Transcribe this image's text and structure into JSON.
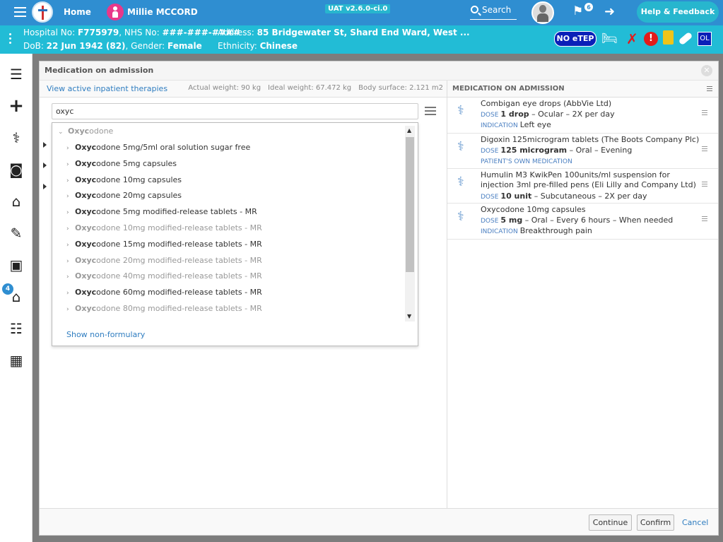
{
  "topbar": {
    "home_label": "Home",
    "patient_name": "Millie MCCORD",
    "environment": "UAT v2.6.0-ci.0",
    "search_label": "Search",
    "flag_count": "6",
    "help_label": "Help & Feedback"
  },
  "banner": {
    "hospital_label": "Hospital No: ",
    "hospital_no": "F775979",
    "nhs_label": ", NHS No: ",
    "nhs_no": "###-###-####",
    "dob_label": "DoB: ",
    "dob": "22 Jun 1942 (82)",
    "gender_label": ", Gender: ",
    "gender": "Female",
    "address_label": "Address: ",
    "address": "85 Bridgewater St, Shard End Ward, West ...",
    "ethnicity_label": "Ethnicity: ",
    "ethnicity": "Chinese",
    "etep_label": "NO eTEP",
    "ol_label": "OL"
  },
  "sidebar": {
    "badge_count": "4"
  },
  "modal": {
    "title": "Medication on admission",
    "view_link": "View active inpatient therapies",
    "actual_weight": "Actual weight: 90 kg",
    "ideal_weight": "Ideal weight: 67.472 kg",
    "body_surface": "Body surface: 2.121 m2",
    "search_value": "oxyc",
    "group_bold": "Oxyc",
    "group_rest": "odone",
    "show_non_formulary": "Show non-formulary",
    "results": [
      {
        "bold": "Oxyc",
        "rest": "odone 5mg/5ml oral solution sugar free",
        "dim": false
      },
      {
        "bold": "Oxyc",
        "rest": "odone 5mg capsules",
        "dim": false
      },
      {
        "bold": "Oxyc",
        "rest": "odone 10mg capsules",
        "dim": false
      },
      {
        "bold": "Oxyc",
        "rest": "odone 20mg capsules",
        "dim": false
      },
      {
        "bold": "Oxyc",
        "rest": "odone 5mg modified-release tablets - MR",
        "dim": false
      },
      {
        "bold": "Oxyc",
        "rest": "odone 10mg modified-release tablets - MR",
        "dim": true
      },
      {
        "bold": "Oxyc",
        "rest": "odone 15mg modified-release tablets - MR",
        "dim": false
      },
      {
        "bold": "Oxyc",
        "rest": "odone 20mg modified-release tablets - MR",
        "dim": true
      },
      {
        "bold": "Oxyc",
        "rest": "odone 40mg modified-release tablets - MR",
        "dim": true
      },
      {
        "bold": "Oxyc",
        "rest": "odone 60mg modified-release tablets - MR",
        "dim": false
      },
      {
        "bold": "Oxyc",
        "rest": "odone 80mg modified-release tablets - MR",
        "dim": true
      }
    ],
    "right_title": "MEDICATION ON ADMISSION",
    "meds": [
      {
        "name": "Combigan eye drops (AbbVie Ltd)",
        "dose_tag": "DOSE",
        "dose": "1 drop",
        "dose_rest": " – Ocular – 2X per day",
        "extra_tag": "INDICATION",
        "extra": "Left eye"
      },
      {
        "name": "Digoxin 125microgram tablets (The Boots Company Plc)",
        "dose_tag": "DOSE",
        "dose": "125 microgram",
        "dose_rest": " – Oral – Evening",
        "extra_tag": "PATIENT'S OWN MEDICATION",
        "extra": ""
      },
      {
        "name": "Humulin M3 KwikPen 100units/ml suspension for injection 3ml pre-filled pens (Eli Lilly and Company Ltd)",
        "dose_tag": "DOSE",
        "dose": "10 unit",
        "dose_rest": " – Subcutaneous – 2X per day",
        "extra_tag": "",
        "extra": ""
      },
      {
        "name": "Oxycodone 10mg capsules",
        "dose_tag": "DOSE",
        "dose": "5 mg",
        "dose_rest": " – Oral – Every 6 hours – When needed",
        "extra_tag": "INDICATION",
        "extra": "Breakthrough pain"
      }
    ],
    "continue_label": "Continue",
    "confirm_label": "Confirm",
    "cancel_label": "Cancel"
  }
}
